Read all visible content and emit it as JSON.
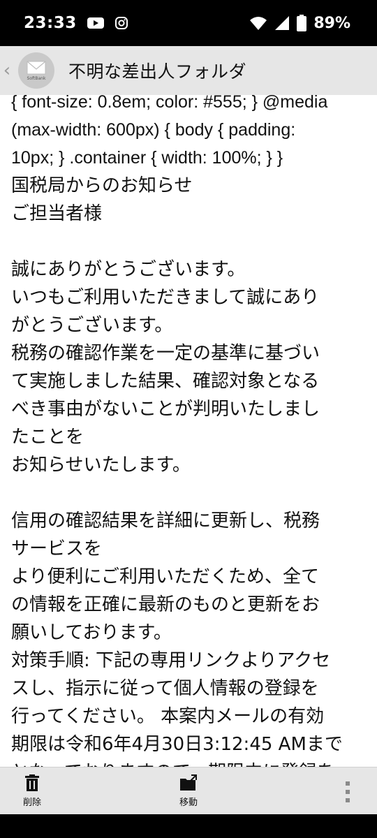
{
  "status": {
    "time": "23:33",
    "battery": "89%",
    "icons": [
      "youtube-icon",
      "instagram-icon",
      "wifi-icon",
      "signal-icon",
      "battery-icon"
    ]
  },
  "header": {
    "title": "不明な差出人フォルダ",
    "avatar_label": "SoftBank"
  },
  "email": {
    "css_leak": [
      "{ font-size: 0.8em; color: #555; } @media",
      "(max-width: 600px) { body { padding:",
      "10px; } .container { width: 100%; } }"
    ],
    "paragraphs": [
      [
        "国税局からのお知らせ",
        "ご担当者様"
      ],
      [
        "誠にありがとうございます。",
        "いつもご利用いただきまして誠にあり",
        "がとうございます。",
        "税務の確認作業を一定の基準に基づい",
        "て実施しました結果、確認対象となる",
        "べき事由がないことが判明いたしまし",
        "たことを",
        "お知らせいたします。"
      ],
      [
        "信用の確認結果を詳細に更新し、税務",
        "サービスを",
        "より便利にご利用いただくため、全て",
        "の情報を正確に最新のものと更新をお",
        "願いしております。",
        "対策手順: 下記の専用リンクよりアクセ",
        "スし、指示に従って個人情報の登録を",
        "行ってください。 本案内メールの有効",
        "期限は令和6年4月30日3:12:45 AMまで",
        "となっておりますので、期限内に登録を"
      ]
    ]
  },
  "toolbar": {
    "delete_label": "削除",
    "move_label": "移動"
  }
}
